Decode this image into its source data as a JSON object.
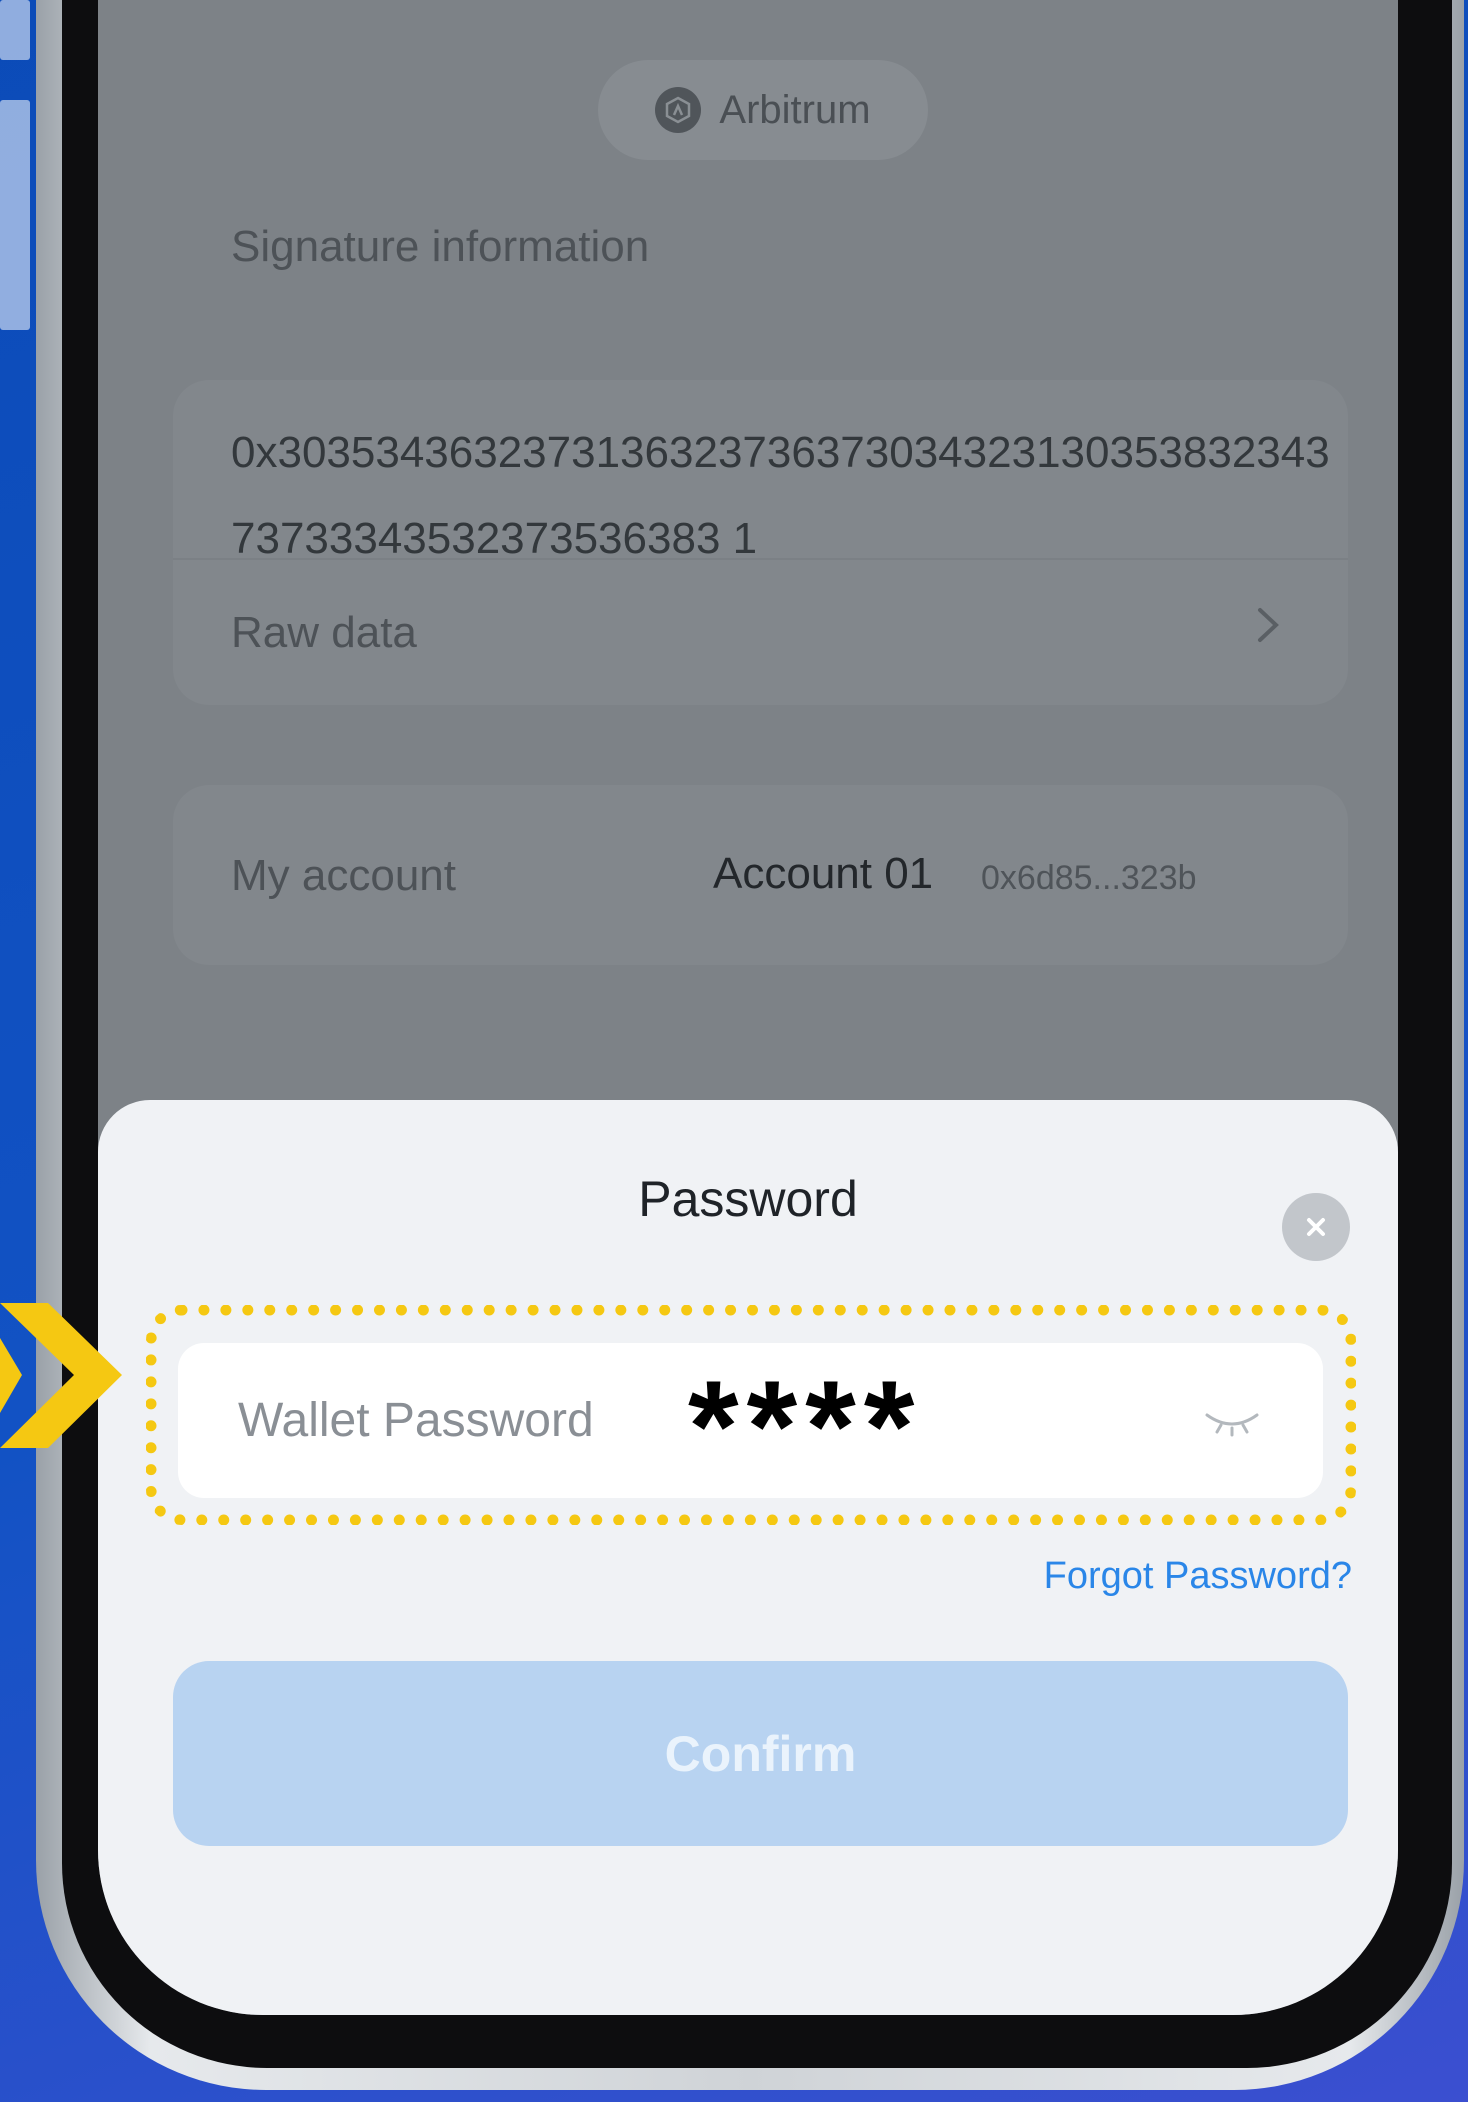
{
  "chain": {
    "name": "Arbitrum",
    "icon": "arbitrum-logo-icon"
  },
  "signature": {
    "section_title": "Signature information",
    "hex": "0x303534363237313632373637303432313035383234373733343532373536383 1",
    "raw_label": "Raw data"
  },
  "account": {
    "label": "My account",
    "name": "Account 01",
    "address": "0x6d85...323b"
  },
  "password_sheet": {
    "title": "Password",
    "placeholder": "Wallet Password",
    "value": "****",
    "forgot_link": "Forgot Password?",
    "confirm_label": "Confirm"
  },
  "colors": {
    "highlight": "#f5c812",
    "link": "#2a86e8",
    "confirm_disabled": "#b8d3f1",
    "background": "#0b4bb8"
  }
}
